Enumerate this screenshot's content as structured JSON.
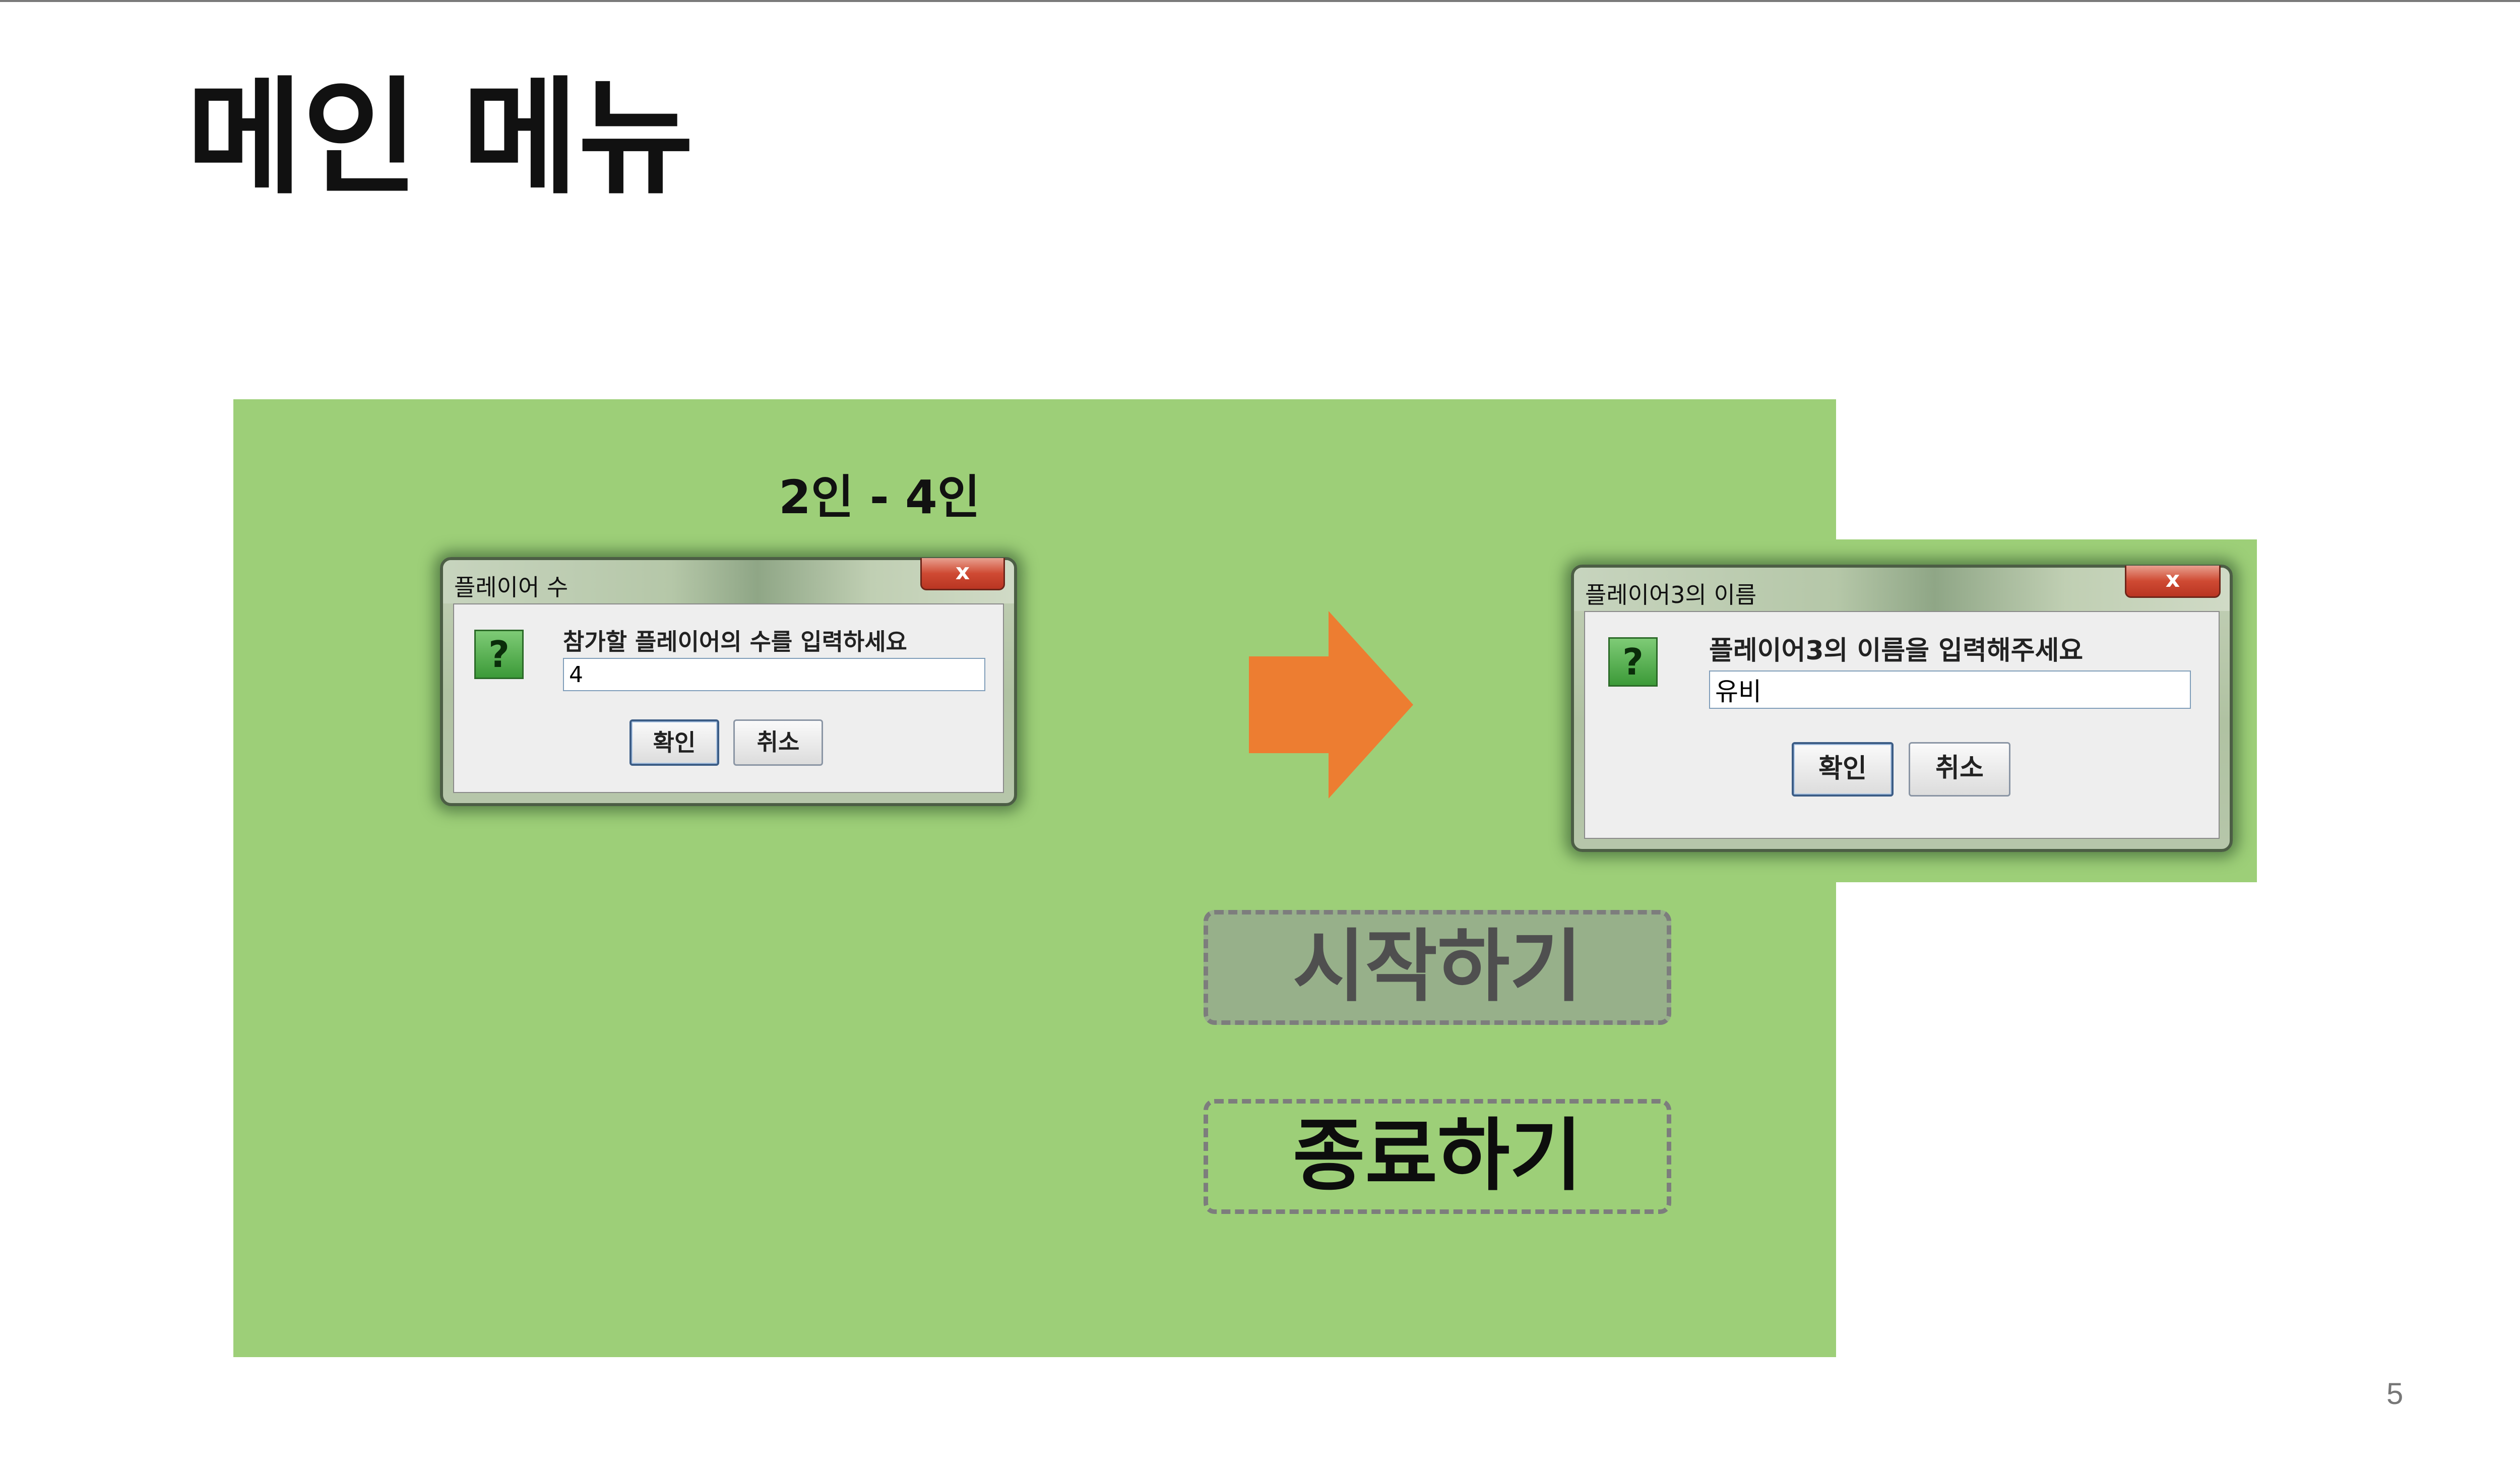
{
  "slide": {
    "title": "메인 메뉴",
    "page_number": "5"
  },
  "main_menu": {
    "range_label": "2인 - 4인",
    "start_label": "시작하기",
    "exit_label": "종료하기"
  },
  "dialog_players": {
    "title": "플레이어 수",
    "close_label": "x",
    "icon": "question-icon",
    "icon_glyph": "?",
    "prompt": "참가할 플레이어의 수를 입력하세요",
    "input_value": "4",
    "ok_label": "확인",
    "cancel_label": "취소"
  },
  "dialog_name": {
    "title": "플레이어3의 이름",
    "close_label": "x",
    "icon": "question-icon",
    "icon_glyph": "?",
    "prompt": "플레이어3의 이름을 입력해주세요",
    "input_value": "유비",
    "ok_label": "확인",
    "cancel_label": "취소"
  },
  "colors": {
    "panel_green": "#9dcf78",
    "arrow_orange": "#ed7d31",
    "start_button_bg": "#97b08a",
    "close_red": "#cf4a33"
  }
}
